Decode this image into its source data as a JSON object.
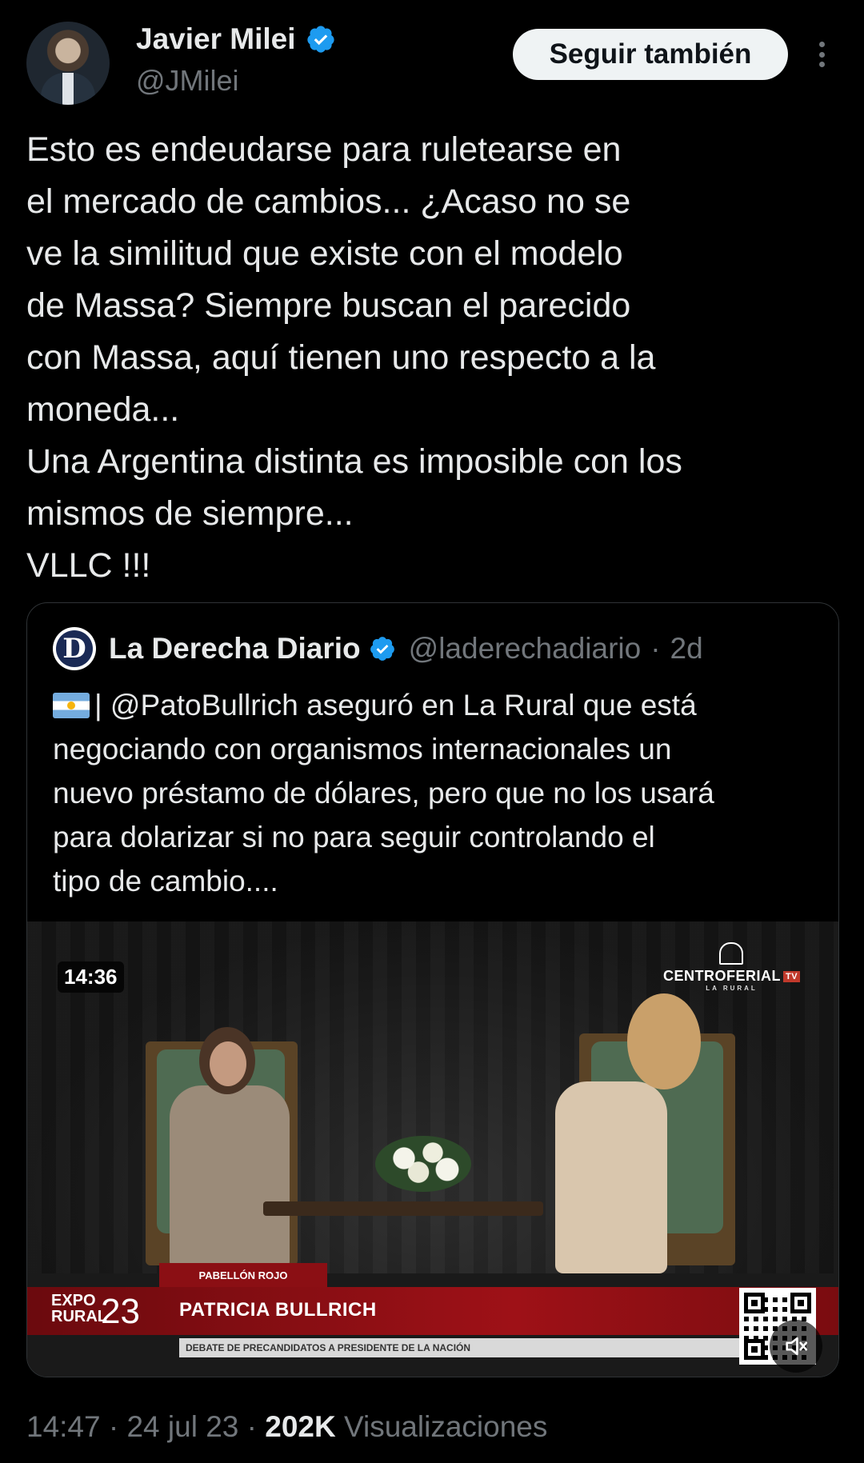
{
  "author": {
    "name": "Javier Milei",
    "handle": "@JMilei",
    "verified": true,
    "verified_color": "#1d9bf0"
  },
  "actions": {
    "follow_label": "Seguir también",
    "more_icon": "more-vertical-icon"
  },
  "tweet": {
    "lines": [
      "Esto es endeudarse para ruletearse en",
      "el mercado de cambios... ¿Acaso no se",
      "ve la similitud que existe con el modelo",
      "de Massa? Siempre buscan el parecido",
      "con Massa, aquí tienen uno respecto a la",
      "moneda...",
      "Una Argentina distinta es imposible con los",
      "mismos de siempre...",
      "VLLC !!!"
    ]
  },
  "quoted": {
    "name": "La Derecha Diario",
    "handle": "@laderechadiario",
    "separator": "·",
    "age": "2d",
    "avatar_letter": "D",
    "flag_icon": "argentina-flag-icon",
    "text_first": "| @PatoBullrich aseguró en La Rural que está",
    "lines": [
      "negociando con organismos internacionales un",
      "nuevo préstamo de dólares, pero que no los usará",
      "para dolarizar si no para seguir controlando el",
      "tipo de cambio...."
    ],
    "video": {
      "timestamp": "14:36",
      "brand_main": "CENTROFERIAL",
      "brand_tv": "TV",
      "brand_sub": "LA RURAL",
      "pabellon": "PABELLÓN ROJO",
      "expo_line1": "EXPO",
      "expo_line2": "RURAL",
      "expo_year": "23",
      "speaker": "PATRICIA BULLRICH",
      "ticker": "DEBATE DE PRECANDIDATOS A PRESIDENTE DE LA NACIÓN",
      "mute_icon": "muted-speaker-icon"
    }
  },
  "footer": {
    "time": "14:47",
    "sep1": "·",
    "date": "24 jul 23",
    "sep2": "·",
    "views": "202K",
    "views_label": "Visualizaciones"
  }
}
